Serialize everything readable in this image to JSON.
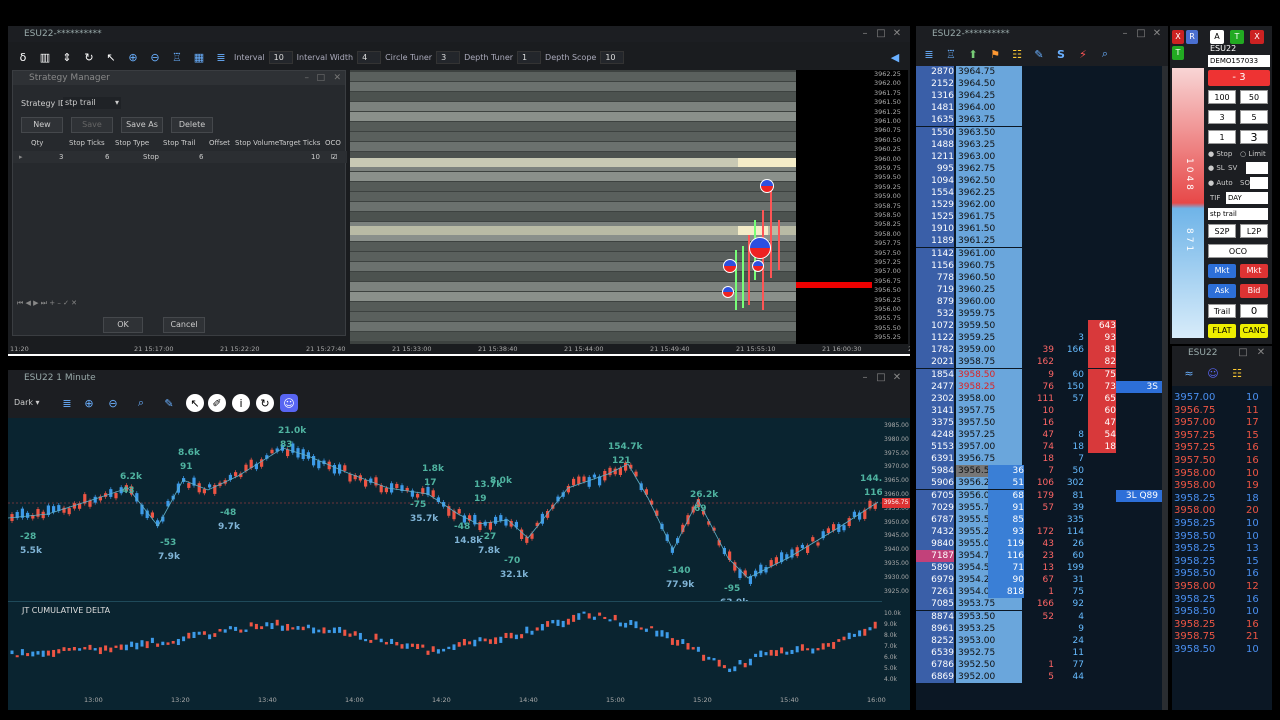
{
  "heatmap_window": {
    "title": "ESU22-**********",
    "toolbar": {
      "interval_label": "Interval",
      "interval_value": "10",
      "width_label": "Interval Width",
      "width_value": "4",
      "circle_label": "Circle Tuner",
      "circle_value": "3",
      "depth_label": "Depth Tuner",
      "depth_value": "1",
      "scope_label": "Depth Scope",
      "scope_value": "10"
    },
    "price_ticks": [
      "3962.25",
      "3962.00",
      "3961.75",
      "3961.50",
      "3961.25",
      "3961.00",
      "3960.75",
      "3960.50",
      "3960.25",
      "3960.00",
      "3959.75",
      "3959.50",
      "3959.25",
      "3959.00",
      "3958.75",
      "3958.50",
      "3958.25",
      "3958.00",
      "3957.75",
      "3957.50",
      "3957.25",
      "3957.00",
      "3956.75",
      "3956.50",
      "3956.25",
      "3956.00",
      "3955.75",
      "3955.50",
      "3955.25"
    ],
    "time_ticks": [
      "11:20",
      "21 15:17:00",
      "21 15:22:20",
      "21 15:27:40",
      "21 15:33:00",
      "21 15:38:40",
      "21 15:44:00",
      "21 15:49:40",
      "21 15:55:10",
      "21 16:00:30",
      "21 16:05:50"
    ]
  },
  "strategy_manager": {
    "title": "Strategy Manager",
    "id_label": "Strategy ID",
    "id_value": "stp trail",
    "buttons": {
      "new": "New",
      "save": "Save",
      "save_as": "Save As",
      "delete": "Delete",
      "ok": "OK",
      "cancel": "Cancel"
    },
    "columns": [
      "Qty",
      "Stop Ticks",
      "Stop Type",
      "Stop Trail",
      "Offset",
      "Stop Volume",
      "Target Ticks",
      "OCO"
    ],
    "row": {
      "qty": "3",
      "stop_ticks": "6",
      "stop_type": "Stop",
      "stop_trail": "6",
      "target_ticks": "10"
    }
  },
  "chart_window": {
    "title": "ESU22 1 Minute",
    "theme_select": "Dark",
    "indicator_label": "JT CUMULATIVE DELTA",
    "current_price": "3956.75",
    "price_axis": [
      "3985.00",
      "3980.00",
      "3975.00",
      "3970.00",
      "3965.00",
      "3960.00",
      "3955.00",
      "3950.00",
      "3945.00",
      "3940.00",
      "3935.00",
      "3930.00",
      "3925.00"
    ],
    "delta_axis": [
      "10.0k",
      "9.0k",
      "8.0k",
      "7.0k",
      "6.0k",
      "5.0k",
      "4.0k"
    ],
    "time_axis": [
      "13:00",
      "13:20",
      "13:40",
      "14:00",
      "14:20",
      "14:40",
      "15:00",
      "15:20",
      "15:40",
      "16:00"
    ],
    "annotations": [
      {
        "t": "-28",
        "c": "#4fb3a0"
      },
      {
        "t": "5.5k",
        "c": "#7fb3d5"
      },
      {
        "t": "6.2k",
        "c": "#4fb3a0"
      },
      {
        "t": "43",
        "c": "#4fb3a0"
      },
      {
        "t": "-53",
        "c": "#4fb3a0"
      },
      {
        "t": "7.9k",
        "c": "#7fb3d5"
      },
      {
        "t": "8.6k",
        "c": "#4fb3a0"
      },
      {
        "t": "91",
        "c": "#4fb3a0"
      },
      {
        "t": "-48",
        "c": "#4fb3a0"
      },
      {
        "t": "9.7k",
        "c": "#7fb3d5"
      },
      {
        "t": "21.0k",
        "c": "#4fb3a0"
      },
      {
        "t": "83",
        "c": "#4fb3a0"
      },
      {
        "t": "-75",
        "c": "#4fb3a0"
      },
      {
        "t": "35.7k",
        "c": "#7fb3d5"
      },
      {
        "t": "1.8k",
        "c": "#4fb3a0"
      },
      {
        "t": "17",
        "c": "#4fb3a0"
      },
      {
        "t": "-48",
        "c": "#4fb3a0"
      },
      {
        "t": "14.8k",
        "c": "#7fb3d5"
      },
      {
        "t": "13.7k",
        "c": "#4fb3a0"
      },
      {
        "t": "19",
        "c": "#4fb3a0"
      },
      {
        "t": "8.0k",
        "c": "#4fb3a0"
      },
      {
        "t": "-27",
        "c": "#4fb3a0"
      },
      {
        "t": "7.8k",
        "c": "#7fb3d5"
      },
      {
        "t": "-70",
        "c": "#4fb3a0"
      },
      {
        "t": "32.1k",
        "c": "#7fb3d5"
      },
      {
        "t": "154.7k",
        "c": "#4fb3a0"
      },
      {
        "t": "121",
        "c": "#4fb3a0"
      },
      {
        "t": "-140",
        "c": "#4fb3a0"
      },
      {
        "t": "77.9k",
        "c": "#7fb3d5"
      },
      {
        "t": "26.2k",
        "c": "#4fb3a0"
      },
      {
        "t": "69",
        "c": "#4fb3a0"
      },
      {
        "t": "-95",
        "c": "#4fb3a0"
      },
      {
        "t": "63.9k",
        "c": "#7fb3d5"
      },
      {
        "t": "144.7k",
        "c": "#4fb3a0"
      },
      {
        "t": "116",
        "c": "#4fb3a0"
      }
    ]
  },
  "dom_window": {
    "title": "ESU22-**********",
    "rows": [
      [
        "2870",
        "3964.75",
        "",
        "",
        ""
      ],
      [
        "2152",
        "3964.50",
        "",
        "",
        ""
      ],
      [
        "1316",
        "3964.25",
        "",
        "",
        ""
      ],
      [
        "1481",
        "3964.00",
        "",
        "",
        ""
      ],
      [
        "1635",
        "3963.75",
        "",
        "",
        ""
      ],
      [
        "1550",
        "3963.50",
        "",
        "",
        ""
      ],
      [
        "1488",
        "3963.25",
        "",
        "",
        ""
      ],
      [
        "1211",
        "3963.00",
        "",
        "",
        ""
      ],
      [
        "995",
        "3962.75",
        "",
        "",
        ""
      ],
      [
        "1094",
        "3962.50",
        "",
        "",
        ""
      ],
      [
        "1554",
        "3962.25",
        "",
        "",
        ""
      ],
      [
        "1529",
        "3962.00",
        "",
        "",
        ""
      ],
      [
        "1525",
        "3961.75",
        "",
        "",
        ""
      ],
      [
        "1910",
        "3961.50",
        "",
        "",
        ""
      ],
      [
        "1189",
        "3961.25",
        "",
        "",
        ""
      ],
      [
        "1142",
        "3961.00",
        "",
        "",
        ""
      ],
      [
        "1156",
        "3960.75",
        "",
        "",
        ""
      ],
      [
        "778",
        "3960.50",
        "",
        "",
        ""
      ],
      [
        "719",
        "3960.25",
        "",
        "",
        ""
      ],
      [
        "879",
        "3960.00",
        "",
        "",
        ""
      ],
      [
        "532",
        "3959.75",
        "",
        "",
        ""
      ],
      [
        "1072",
        "3959.50",
        "",
        "",
        "643"
      ],
      [
        "1122",
        "3959.25",
        "",
        "3",
        "93"
      ],
      [
        "1782",
        "3959.00",
        "39",
        "166",
        "81"
      ],
      [
        "2021",
        "3958.75",
        "162",
        "",
        "82"
      ],
      [
        "1854",
        "3958.50",
        "9",
        "60",
        "75"
      ],
      [
        "2477",
        "3958.25",
        "76",
        "150",
        "73"
      ],
      [
        "2302",
        "3958.00",
        "111",
        "57",
        "65"
      ],
      [
        "3141",
        "3957.75",
        "10",
        "",
        "60"
      ],
      [
        "3375",
        "3957.50",
        "16",
        "",
        "47"
      ],
      [
        "4248",
        "3957.25",
        "47",
        "8",
        "54"
      ],
      [
        "5153",
        "3957.00",
        "74",
        "18",
        "18"
      ],
      [
        "6391",
        "3956.75",
        "18",
        "7",
        ""
      ],
      [
        "5984",
        "3956.50",
        "7",
        "50",
        ""
      ],
      [
        "5906",
        "3956.25",
        "106",
        "302",
        ""
      ],
      [
        "6705",
        "3956.00",
        "179",
        "81",
        ""
      ],
      [
        "7029",
        "3955.75",
        "57",
        "39",
        ""
      ],
      [
        "6787",
        "3955.50",
        "",
        "335",
        ""
      ],
      [
        "7432",
        "3955.25",
        "172",
        "114",
        ""
      ],
      [
        "9840",
        "3955.00",
        "43",
        "26",
        ""
      ],
      [
        "7187",
        "3954.75",
        "23",
        "60",
        ""
      ],
      [
        "5890",
        "3954.50",
        "13",
        "199",
        ""
      ],
      [
        "6979",
        "3954.25",
        "67",
        "31",
        ""
      ],
      [
        "7261",
        "3954.00",
        "1",
        "75",
        ""
      ],
      [
        "7085",
        "3953.75",
        "166",
        "92",
        ""
      ],
      [
        "8874",
        "3953.50",
        "52",
        "4",
        ""
      ],
      [
        "8961",
        "3953.25",
        "",
        "9",
        ""
      ],
      [
        "8252",
        "3953.00",
        "",
        "24",
        ""
      ],
      [
        "6539",
        "3952.75",
        "",
        "11",
        ""
      ],
      [
        "6786",
        "3952.50",
        "1",
        "77",
        ""
      ],
      [
        "6869",
        "3952.00",
        "5",
        "44",
        ""
      ]
    ],
    "bid_sizes": {
      "33": "36",
      "34": "51",
      "35": "68",
      "36": "91",
      "37": "85",
      "38": "93",
      "39": "119",
      "40": "116",
      "41": "71",
      "42": "90",
      "43": "818"
    },
    "order_markers": {
      "position": "3S",
      "order": "3L Q89"
    }
  },
  "order_ticket": {
    "instrument": "ESU22",
    "account": "DEMO157033",
    "position": "- 3",
    "qty_presets": [
      "100",
      "50",
      "3",
      "5",
      "1"
    ],
    "qty_value": "3",
    "stop_label": "Stop",
    "limit_label": "Limit",
    "sl_label": "SL",
    "sv_label": "SV",
    "auto_label": "Auto",
    "so_label": "SO",
    "tif_label": "TIF",
    "tif_value": "DAY",
    "strategy": "stp trail",
    "s2p": "S2P",
    "l2p": "L2P",
    "oco": "OCO",
    "mkt": "Mkt",
    "ask": "Ask",
    "bid": "Bid",
    "trail": "Trail",
    "trail_value": "0",
    "flat": "FLAT",
    "canc": "CANC",
    "pnl_top": "1048",
    "pnl_bottom": "871"
  },
  "time_sales": {
    "title": "ESU22",
    "rows": [
      [
        "3957.00",
        "10",
        "blue"
      ],
      [
        "3956.75",
        "11",
        "red"
      ],
      [
        "3957.00",
        "17",
        "red"
      ],
      [
        "3957.25",
        "15",
        "red"
      ],
      [
        "3957.25",
        "16",
        "red"
      ],
      [
        "3957.50",
        "16",
        "red"
      ],
      [
        "3958.00",
        "10",
        "red"
      ],
      [
        "3958.00",
        "19",
        "red"
      ],
      [
        "3958.25",
        "18",
        "blue"
      ],
      [
        "3958.00",
        "20",
        "red"
      ],
      [
        "3958.25",
        "10",
        "blue"
      ],
      [
        "3958.50",
        "10",
        "blue"
      ],
      [
        "3958.25",
        "13",
        "blue"
      ],
      [
        "3958.25",
        "15",
        "blue"
      ],
      [
        "3958.50",
        "16",
        "blue"
      ],
      [
        "3958.00",
        "12",
        "red"
      ],
      [
        "3958.25",
        "16",
        "blue"
      ],
      [
        "3958.50",
        "10",
        "blue"
      ],
      [
        "3958.25",
        "16",
        "red"
      ],
      [
        "3958.75",
        "21",
        "red"
      ],
      [
        "3958.50",
        "10",
        "blue"
      ]
    ]
  }
}
